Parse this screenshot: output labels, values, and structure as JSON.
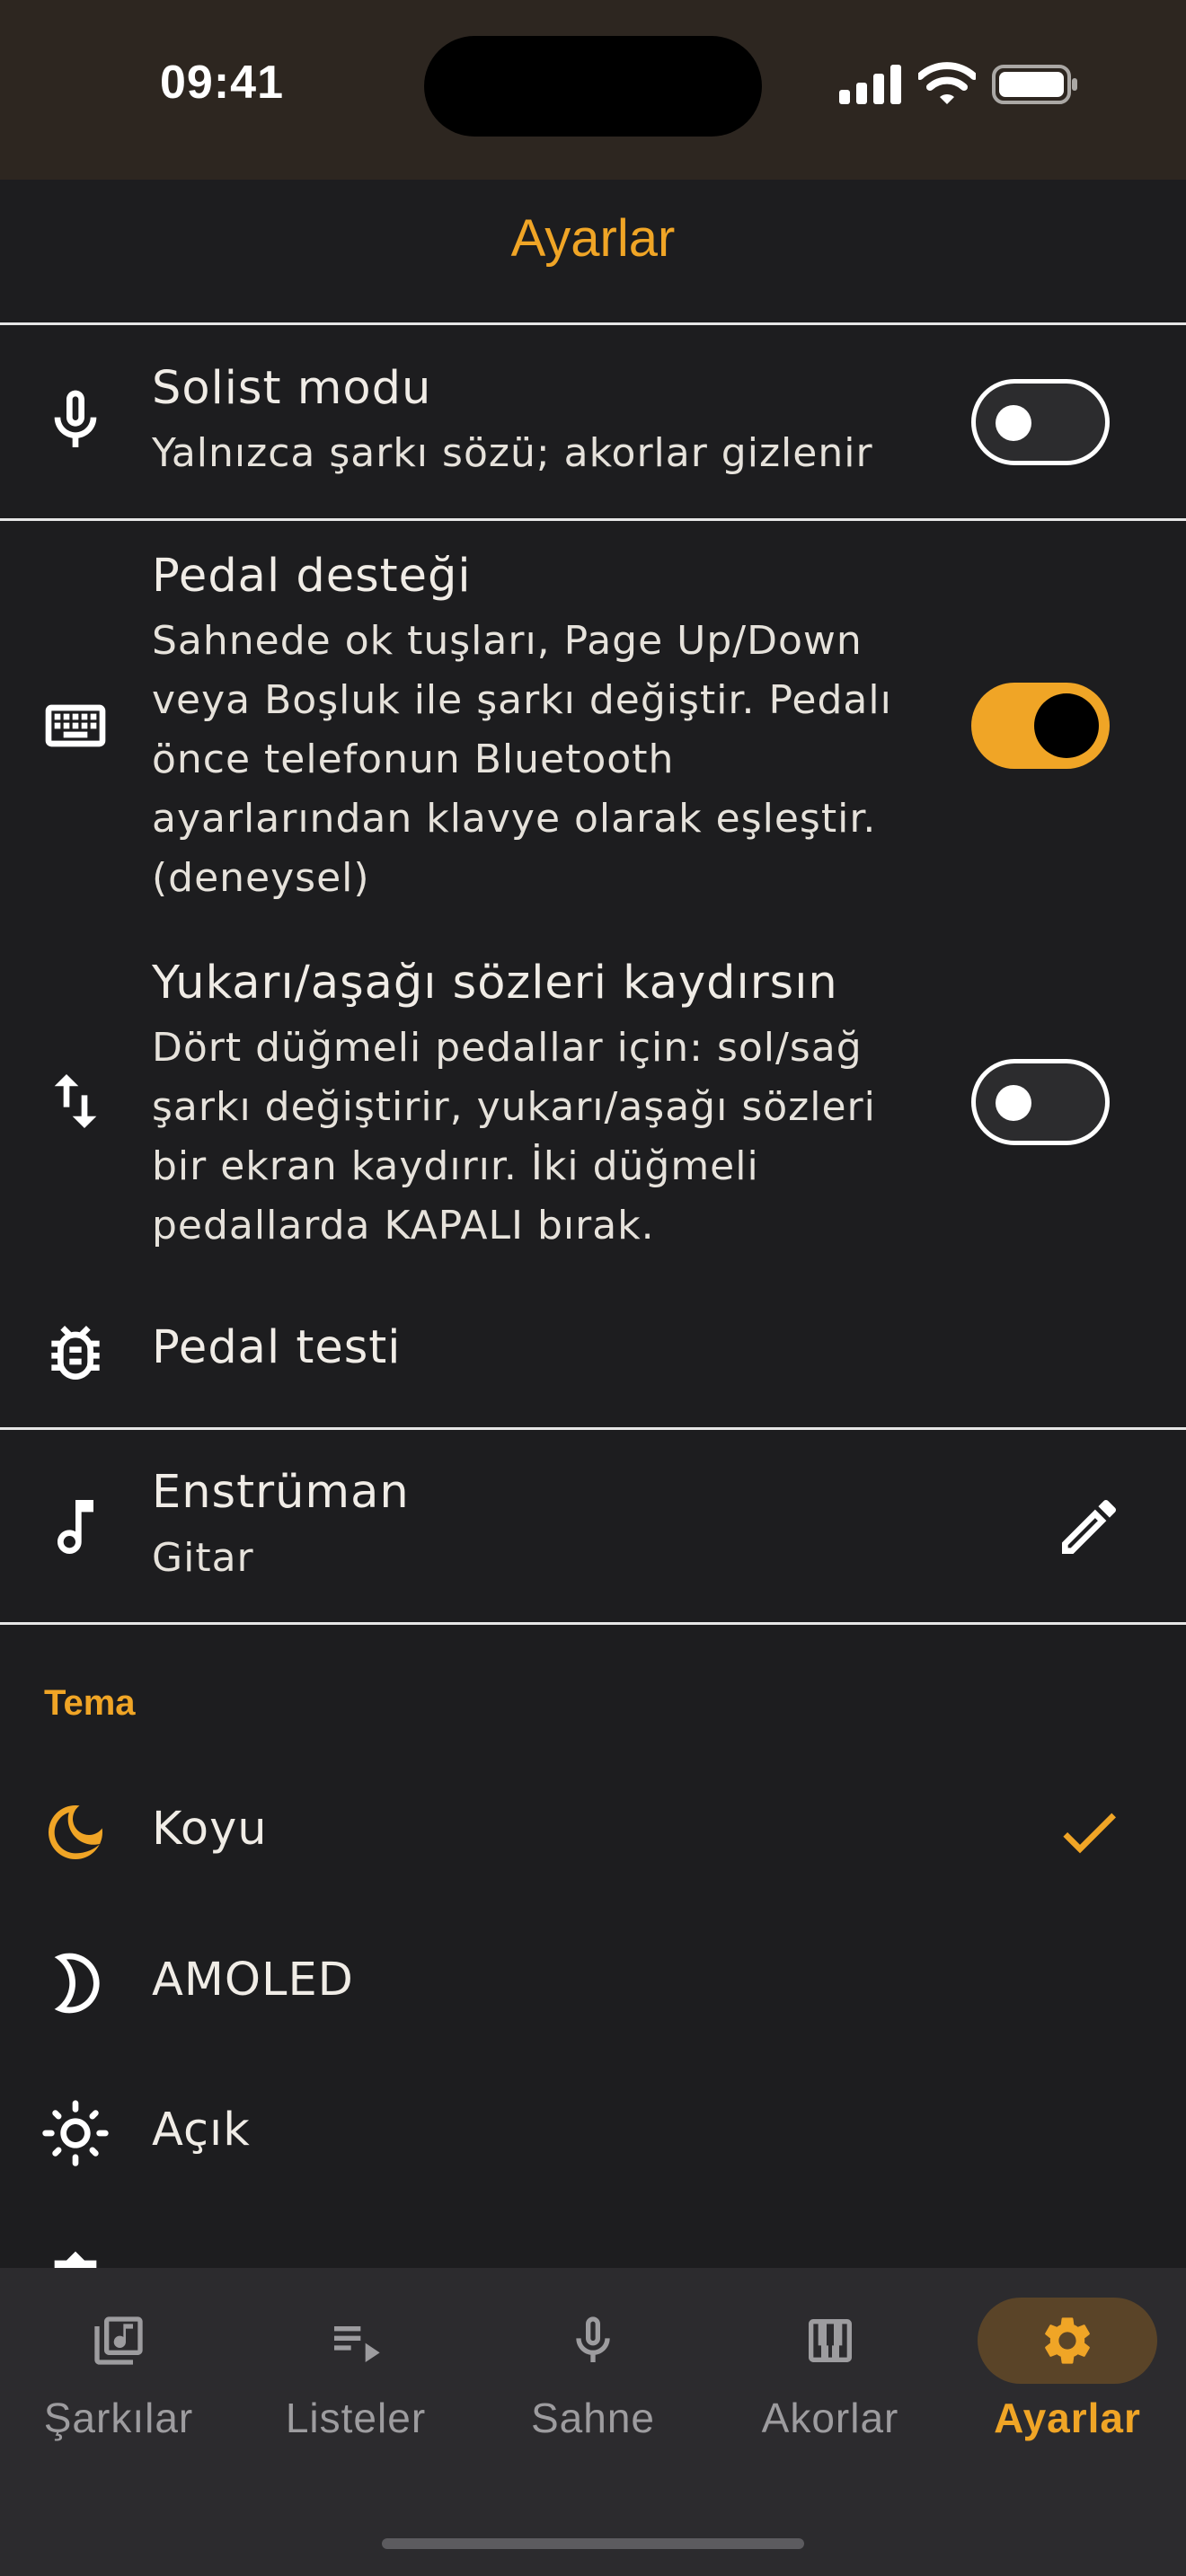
{
  "status_bar": {
    "time": "09:41"
  },
  "header": {
    "title": "Ayarlar"
  },
  "settings": {
    "solist": {
      "title": "Solist modu",
      "subtitle": "Yalnızca şarkı sözü; akorlar gizlenir",
      "enabled": false,
      "icon": "microphone-icon"
    },
    "pedal": {
      "title": "Pedal desteği",
      "description_lines": [
        "Sahnede ok tuşları, Page Up/Down",
        "veya Boşluk ile şarkı değiştir. Pedalı",
        "önce telefonun Bluetooth",
        "ayarlarından klavye olarak eşleştir.",
        "(deneysel)"
      ],
      "enabled": true,
      "icon": "keyboard-icon"
    },
    "scroll": {
      "title": "Yukarı/aşağı sözleri kaydırsın",
      "description_lines": [
        "Dört düğmeli pedallar için: sol/sağ",
        "şarkı değiştirir, yukarı/aşağı sözleri",
        "bir ekran kaydırır. İki düğmeli",
        "pedallarda KAPALI bırak."
      ],
      "enabled": false,
      "icon": "swap-vertical-icon"
    },
    "pedal_test": {
      "title": "Pedal testi",
      "icon": "bug-icon"
    },
    "instrument": {
      "title": "Enstrüman",
      "value": "Gitar",
      "icon": "music-note-icon",
      "action_icon": "pencil-icon"
    }
  },
  "theme": {
    "section_label": "Tema",
    "options": [
      {
        "label": "Koyu",
        "icon": "moon-filled-icon",
        "selected": true
      },
      {
        "label": "AMOLED",
        "icon": "moon-outline-icon",
        "selected": false
      },
      {
        "label": "Açık",
        "icon": "sun-icon",
        "selected": false
      }
    ]
  },
  "bottom_nav": {
    "tabs": [
      {
        "label": "Şarkılar",
        "icon": "music-library-icon",
        "active": false
      },
      {
        "label": "Listeler",
        "icon": "playlist-icon",
        "active": false
      },
      {
        "label": "Sahne",
        "icon": "microphone-icon",
        "active": false
      },
      {
        "label": "Akorlar",
        "icon": "piano-icon",
        "active": false
      },
      {
        "label": "Ayarlar",
        "icon": "gear-icon",
        "active": true
      }
    ]
  },
  "colors": {
    "accent": "#f0a526",
    "background": "#1d1d1f",
    "header": "#2d2620",
    "nav": "#2c2b2e"
  }
}
